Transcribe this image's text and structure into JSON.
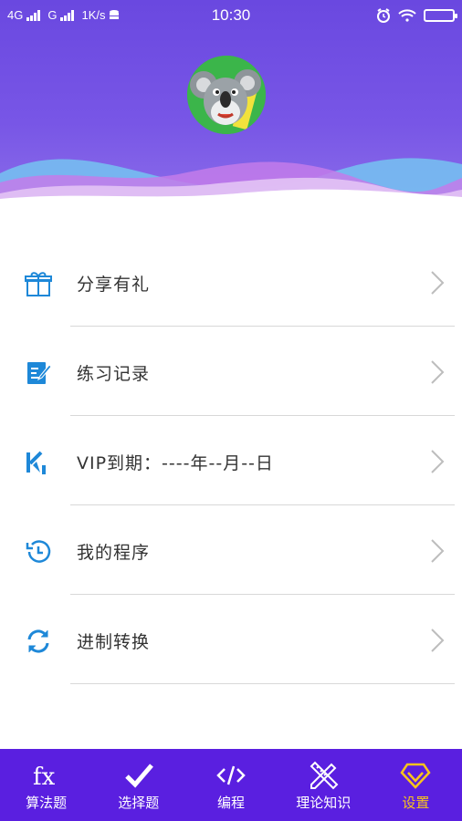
{
  "status_bar": {
    "network1": "4G",
    "network2": "G",
    "speed": "1K/s",
    "time": "10:30"
  },
  "menu": [
    {
      "label": "分享有礼",
      "icon": "gift-icon"
    },
    {
      "label": "练习记录",
      "icon": "edit-note-icon"
    },
    {
      "label": "VIP到期：----年--月--日",
      "icon": "vip-k-icon"
    },
    {
      "label": "我的程序",
      "icon": "history-clock-icon"
    },
    {
      "label": "进制转换",
      "icon": "refresh-icon"
    }
  ],
  "bottom_nav": [
    {
      "label": "算法题",
      "icon": "fx-icon",
      "active": false
    },
    {
      "label": "选择题",
      "icon": "checkmark-icon",
      "active": false
    },
    {
      "label": "编程",
      "icon": "code-icon",
      "active": false
    },
    {
      "label": "理论知识",
      "icon": "pencil-ruler-icon",
      "active": false
    },
    {
      "label": "设置",
      "icon": "diamond-icon",
      "active": true
    }
  ],
  "colors": {
    "header": "#7050e4",
    "accent_icon": "#1e88d8",
    "nav_bg": "#5a1fe0",
    "nav_active": "#f8c41c"
  }
}
